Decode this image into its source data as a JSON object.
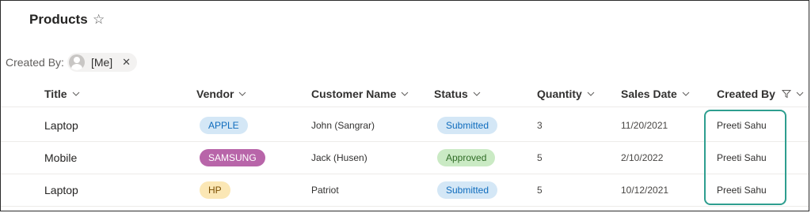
{
  "page": {
    "title": "Products",
    "star_icon": "star-icon"
  },
  "filter": {
    "label": "Created By:",
    "value": "[Me]",
    "avatar_icon": "user-avatar-icon",
    "remove_icon": "close-icon"
  },
  "columns": [
    {
      "label": "Title",
      "icon": "chevron-down-icon"
    },
    {
      "label": "Vendor",
      "icon": "chevron-down-icon"
    },
    {
      "label": "Customer Name",
      "icon": "chevron-down-icon"
    },
    {
      "label": "Status",
      "icon": "chevron-down-icon"
    },
    {
      "label": "Quantity",
      "icon": "chevron-down-icon"
    },
    {
      "label": "Sales Date",
      "icon": "chevron-down-icon"
    },
    {
      "label": "Created By",
      "icon": "filter-icon"
    }
  ],
  "rows": [
    {
      "title": "Laptop",
      "vendor": "APPLE",
      "customer": "John (Sangrar)",
      "status": "Submitted",
      "quantity": "3",
      "date": "11/20/2021",
      "created_by": "Preeti Sahu"
    },
    {
      "title": "Mobile",
      "vendor": "SAMSUNG",
      "customer": "Jack (Husen)",
      "status": "Approved",
      "quantity": "5",
      "date": "2/10/2022",
      "created_by": "Preeti Sahu"
    },
    {
      "title": "Laptop",
      "vendor": "HP",
      "customer": "Patriot",
      "status": "Submitted",
      "quantity": "5",
      "date": "10/12/2021",
      "created_by": "Preeti Sahu"
    }
  ],
  "colors": {
    "vendor_apple_bg": "#d4e7f6",
    "vendor_apple_fg": "#0f6cbd",
    "vendor_samsung_bg": "#b865a9",
    "vendor_samsung_fg": "#ffffff",
    "vendor_hp_bg": "#fbe7b5",
    "vendor_hp_fg": "#7a4e00",
    "status_submitted_bg": "#d4e7f6",
    "status_submitted_fg": "#0f6cbd",
    "status_approved_bg": "#caeac4",
    "status_approved_fg": "#2e6b25",
    "highlight_border": "#2e9e8f"
  }
}
